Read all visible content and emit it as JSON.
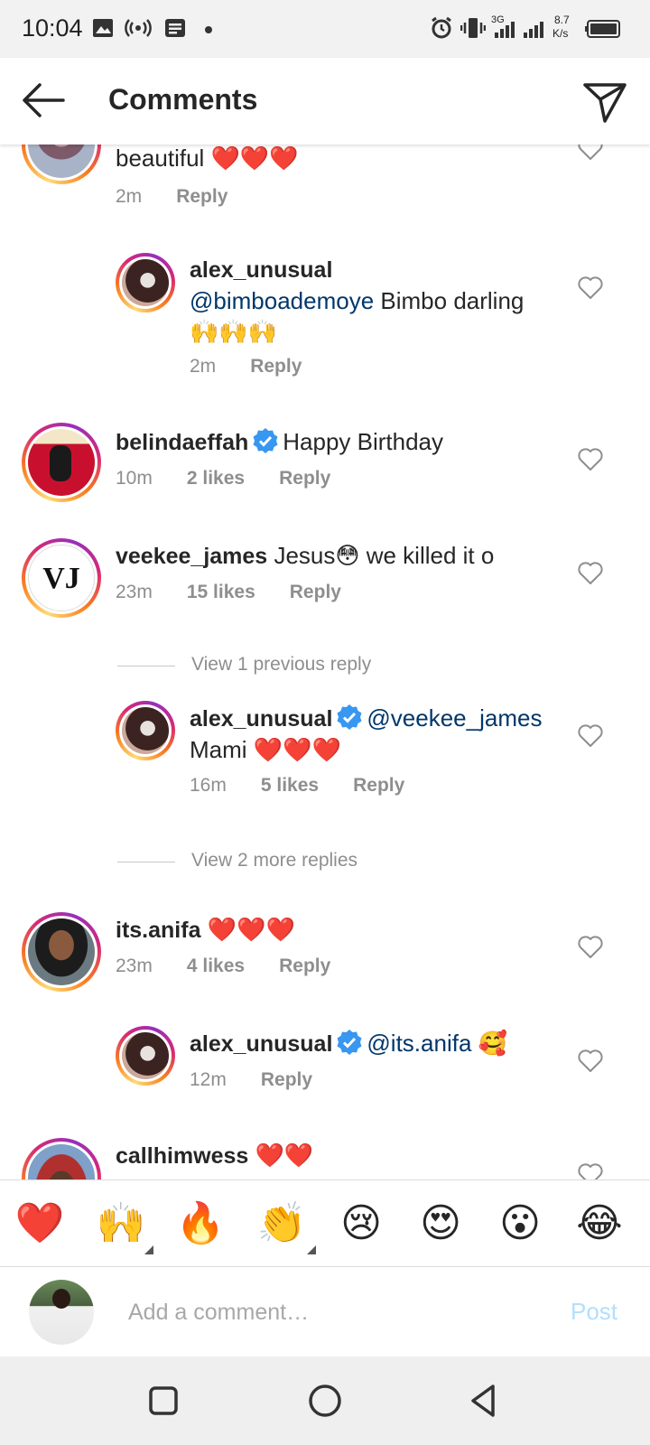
{
  "status_bar": {
    "time": "10:04",
    "network": "3G",
    "speed_value": "8.7",
    "speed_unit": "K/s",
    "icons": [
      "image-icon",
      "hotspot-icon",
      "notes-icon",
      "dot-icon",
      "alarm-icon",
      "vibrate-icon",
      "signal-icon",
      "battery-icon"
    ]
  },
  "header": {
    "title": "Comments",
    "back_icon": "arrow-left-icon",
    "share_icon": "paper-plane-icon"
  },
  "comments": [
    {
      "id": "c0",
      "user": "",
      "text": "beautiful",
      "hearts": "❤️❤️❤️",
      "time": "2m",
      "likes": "",
      "reply": "Reply",
      "partial": true
    },
    {
      "id": "c1",
      "user": "alex_unusual",
      "mention": "@bimboademoye",
      "text": "Bimbo darling",
      "emoji": "🙌🙌🙌",
      "time": "2m",
      "likes": "",
      "reply": "Reply",
      "is_reply": true
    },
    {
      "id": "c2",
      "user": "belindaeffah",
      "verified": true,
      "text": "Happy Birthday",
      "time": "10m",
      "likes": "2 likes",
      "reply": "Reply"
    },
    {
      "id": "c3",
      "user": "veekee_james",
      "text": "Jesus😳 we killed it o",
      "time": "23m",
      "likes": "15 likes",
      "reply": "Reply",
      "avatar_text": "VJ"
    },
    {
      "id": "c4",
      "user": "alex_unusual",
      "verified": true,
      "mention": "@veekee_james",
      "text": "Mami",
      "hearts": "❤️❤️❤️",
      "time": "16m",
      "likes": "5 likes",
      "reply": "Reply",
      "is_reply": true
    },
    {
      "id": "c5",
      "user": "its.anifa",
      "hearts": "❤️❤️❤️",
      "time": "23m",
      "likes": "4 likes",
      "reply": "Reply"
    },
    {
      "id": "c6",
      "user": "alex_unusual",
      "verified": true,
      "mention": "@its.anifa",
      "emoji": "🥰",
      "time": "12m",
      "likes": "",
      "reply": "Reply",
      "is_reply": true
    },
    {
      "id": "c7",
      "user": "callhimwess",
      "hearts": "❤️❤️",
      "partial": true
    }
  ],
  "view_replies": {
    "previous": "View 1 previous reply",
    "more": "View 2 more replies"
  },
  "emoji_bar": [
    "❤️",
    "🙌",
    "🔥",
    "👏",
    "😢",
    "😍",
    "😮",
    "😂"
  ],
  "comment_input": {
    "placeholder": "Add a comment…",
    "post_label": "Post"
  },
  "colors": {
    "mention": "#00376b",
    "meta": "#8e8e8e",
    "verified": "#3897f0",
    "post_disabled": "#b2dffc"
  }
}
